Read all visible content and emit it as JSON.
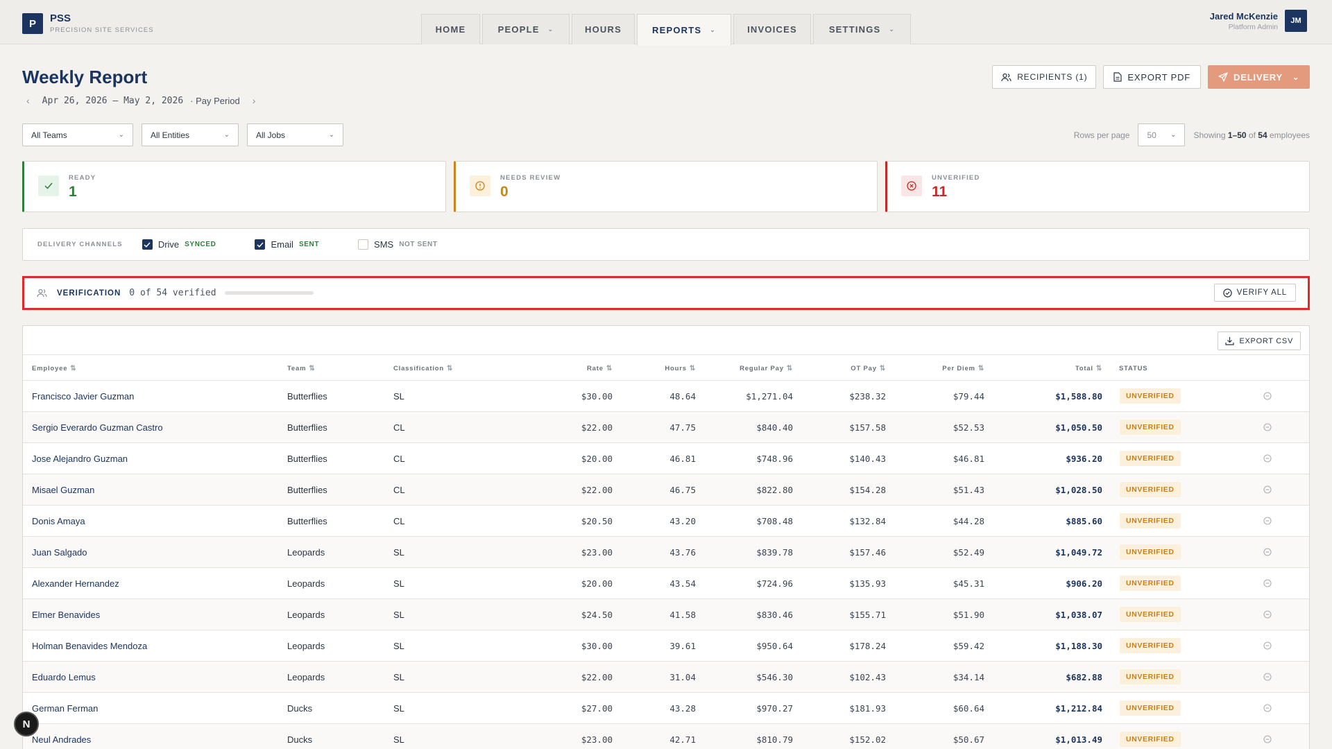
{
  "brand": {
    "logo_letter": "P",
    "name": "PSS",
    "subtitle": "PRECISION SITE SERVICES"
  },
  "nav": {
    "tabs": [
      {
        "label": "HOME",
        "has_menu": false,
        "active": false
      },
      {
        "label": "PEOPLE",
        "has_menu": true,
        "active": false
      },
      {
        "label": "HOURS",
        "has_menu": false,
        "active": false
      },
      {
        "label": "REPORTS",
        "has_menu": true,
        "active": true
      },
      {
        "label": "INVOICES",
        "has_menu": false,
        "active": false
      },
      {
        "label": "SETTINGS",
        "has_menu": true,
        "active": false
      }
    ]
  },
  "user": {
    "name": "Jared McKenzie",
    "role": "Platform Admin",
    "initials": "JM"
  },
  "header": {
    "title": "Weekly Report",
    "period_range": "Apr 26, 2026 – May 2, 2026",
    "period_label": "· Pay Period",
    "prev_icon": "chevron-left-icon",
    "next_icon": "chevron-right-icon"
  },
  "actions": {
    "recipients_label": "RECIPIENTS (1)",
    "export_pdf_label": "EXPORT PDF",
    "delivery_label": "DELIVERY"
  },
  "filters": {
    "teams": "All Teams",
    "entities": "All Entities",
    "jobs": "All Jobs",
    "rows_per_page_label": "Rows per page",
    "rows_per_page_value": "50",
    "showing_prefix": "Showing",
    "showing_range": "1–50",
    "showing_of": "of",
    "showing_total": "54",
    "showing_suffix": "employees"
  },
  "stats": {
    "ready": {
      "label": "READY",
      "value": "1",
      "color": "#2e7d3a"
    },
    "needs_review": {
      "label": "NEEDS REVIEW",
      "value": "0",
      "color": "#c9841d"
    },
    "unverified": {
      "label": "UNVERIFIED",
      "value": "11",
      "color": "#c62828"
    }
  },
  "channels": {
    "title": "DELIVERY CHANNELS",
    "items": [
      {
        "name": "Drive",
        "status": "SYNCED",
        "checked": true,
        "status_color": "#2e7d3a"
      },
      {
        "name": "Email",
        "status": "SENT",
        "checked": true,
        "status_color": "#2e7d3a"
      },
      {
        "name": "SMS",
        "status": "NOT SENT",
        "checked": false,
        "status_color": "#8a8f98"
      }
    ]
  },
  "verification": {
    "title": "VERIFICATION",
    "count_text": "0 of 54 verified",
    "progress": 0,
    "verify_all_label": "VERIFY ALL"
  },
  "table": {
    "export_csv_label": "EXPORT CSV",
    "columns": {
      "employee": "Employee",
      "team": "Team",
      "classification": "Classification",
      "rate": "Rate",
      "hours": "Hours",
      "regular_pay": "Regular Pay",
      "ot_pay": "OT Pay",
      "per_diem": "Per Diem",
      "total": "Total",
      "status": "STATUS"
    },
    "rows": [
      {
        "employee": "Francisco Javier Guzman",
        "team": "Butterflies",
        "classification": "SL",
        "rate": "$30.00",
        "hours": "48.64",
        "regular_pay": "$1,271.04",
        "ot_pay": "$238.32",
        "per_diem": "$79.44",
        "total": "$1,588.80",
        "status": "UNVERIFIED"
      },
      {
        "employee": "Sergio Everardo Guzman Castro",
        "team": "Butterflies",
        "classification": "CL",
        "rate": "$22.00",
        "hours": "47.75",
        "regular_pay": "$840.40",
        "ot_pay": "$157.58",
        "per_diem": "$52.53",
        "total": "$1,050.50",
        "status": "UNVERIFIED"
      },
      {
        "employee": "Jose Alejandro Guzman",
        "team": "Butterflies",
        "classification": "CL",
        "rate": "$20.00",
        "hours": "46.81",
        "regular_pay": "$748.96",
        "ot_pay": "$140.43",
        "per_diem": "$46.81",
        "total": "$936.20",
        "status": "UNVERIFIED"
      },
      {
        "employee": "Misael Guzman",
        "team": "Butterflies",
        "classification": "CL",
        "rate": "$22.00",
        "hours": "46.75",
        "regular_pay": "$822.80",
        "ot_pay": "$154.28",
        "per_diem": "$51.43",
        "total": "$1,028.50",
        "status": "UNVERIFIED"
      },
      {
        "employee": "Donis Amaya",
        "team": "Butterflies",
        "classification": "CL",
        "rate": "$20.50",
        "hours": "43.20",
        "regular_pay": "$708.48",
        "ot_pay": "$132.84",
        "per_diem": "$44.28",
        "total": "$885.60",
        "status": "UNVERIFIED"
      },
      {
        "employee": "Juan Salgado",
        "team": "Leopards",
        "classification": "SL",
        "rate": "$23.00",
        "hours": "43.76",
        "regular_pay": "$839.78",
        "ot_pay": "$157.46",
        "per_diem": "$52.49",
        "total": "$1,049.72",
        "status": "UNVERIFIED"
      },
      {
        "employee": "Alexander Hernandez",
        "team": "Leopards",
        "classification": "SL",
        "rate": "$20.00",
        "hours": "43.54",
        "regular_pay": "$724.96",
        "ot_pay": "$135.93",
        "per_diem": "$45.31",
        "total": "$906.20",
        "status": "UNVERIFIED"
      },
      {
        "employee": "Elmer Benavides",
        "team": "Leopards",
        "classification": "SL",
        "rate": "$24.50",
        "hours": "41.58",
        "regular_pay": "$830.46",
        "ot_pay": "$155.71",
        "per_diem": "$51.90",
        "total": "$1,038.07",
        "status": "UNVERIFIED"
      },
      {
        "employee": "Holman Benavides Mendoza",
        "team": "Leopards",
        "classification": "SL",
        "rate": "$30.00",
        "hours": "39.61",
        "regular_pay": "$950.64",
        "ot_pay": "$178.24",
        "per_diem": "$59.42",
        "total": "$1,188.30",
        "status": "UNVERIFIED"
      },
      {
        "employee": "Eduardo Lemus",
        "team": "Leopards",
        "classification": "SL",
        "rate": "$22.00",
        "hours": "31.04",
        "regular_pay": "$546.30",
        "ot_pay": "$102.43",
        "per_diem": "$34.14",
        "total": "$682.88",
        "status": "UNVERIFIED"
      },
      {
        "employee": "German Ferman",
        "team": "Ducks",
        "classification": "SL",
        "rate": "$27.00",
        "hours": "43.28",
        "regular_pay": "$970.27",
        "ot_pay": "$181.93",
        "per_diem": "$60.64",
        "total": "$1,212.84",
        "status": "UNVERIFIED"
      },
      {
        "employee": "Neul Andrades",
        "team": "Ducks",
        "classification": "SL",
        "rate": "$23.00",
        "hours": "42.71",
        "regular_pay": "$810.79",
        "ot_pay": "$152.02",
        "per_diem": "$50.67",
        "total": "$1,013.49",
        "status": "UNVERIFIED"
      }
    ]
  },
  "fab": {
    "label": "N"
  }
}
